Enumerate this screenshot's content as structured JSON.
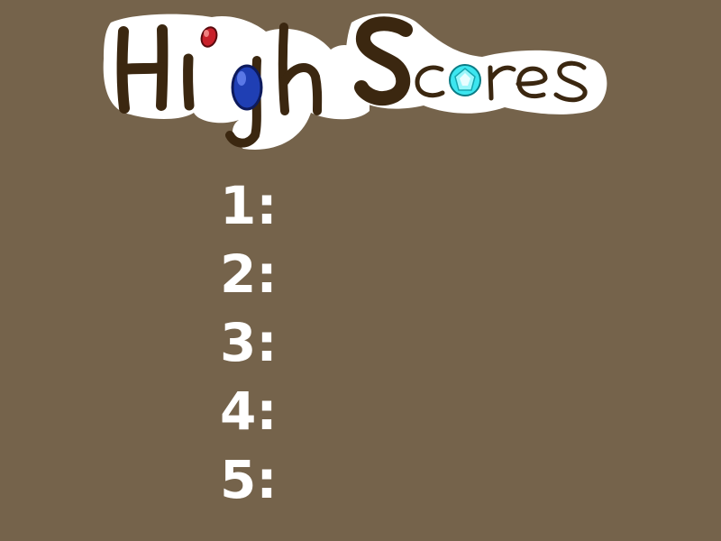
{
  "title": {
    "text": "High Scores",
    "text_color": "#3b2710",
    "outline_color": "#ffffff",
    "gem_colors": [
      "#c8202a",
      "#1f3fb4",
      "#3ce6f0"
    ]
  },
  "scores": [
    {
      "rank": "1:",
      "value": ""
    },
    {
      "rank": "2:",
      "value": ""
    },
    {
      "rank": "3:",
      "value": ""
    },
    {
      "rank": "4:",
      "value": ""
    },
    {
      "rank": "5:",
      "value": ""
    }
  ],
  "colors": {
    "background": "#75634b",
    "list_text": "#ffffff"
  }
}
